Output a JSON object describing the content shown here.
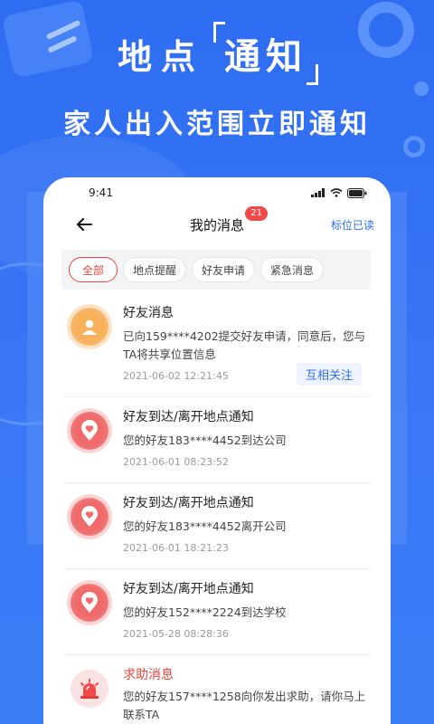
{
  "promo": {
    "headline_left": "地点",
    "headline_right": "通知",
    "subline": "家人出入范围立即通知"
  },
  "status_bar": {
    "time": "9:41"
  },
  "nav": {
    "title": "我的消息",
    "badge": "21",
    "mark_read": "标位已读"
  },
  "tabs": [
    {
      "label": "全部",
      "active": true
    },
    {
      "label": "地点提醒",
      "active": false
    },
    {
      "label": "好友申请",
      "active": false
    },
    {
      "label": "紧急消息",
      "active": false
    }
  ],
  "messages": [
    {
      "icon": "user-icon",
      "title": "好友消息",
      "desc": "已向159****4202提交好友申请，同意后，您与TA将共享位置信息",
      "time": "2021-06-02  12:21:45",
      "action": "互相关注"
    },
    {
      "icon": "location-heart-icon",
      "title": "好友到达/离开地点通知",
      "desc": "您的好友183****4452到达公司",
      "time": "2021-06-01  08:23:52"
    },
    {
      "icon": "location-heart-icon",
      "title": "好友到达/离开地点通知",
      "desc": "您的好友183****4452离开公司",
      "time": "2021-06-01  18:21:23"
    },
    {
      "icon": "location-heart-icon",
      "title": "好友到达/离开地点通知",
      "desc": "您的好友152****2224到达学校",
      "time": "2021-05-28  08:28:36"
    },
    {
      "icon": "alarm-icon",
      "title": "求助消息",
      "desc": "您的好友157****1258向你发出求助，请你马上联系TA"
    }
  ],
  "colors": {
    "brand_blue": "#2f6ff0",
    "alert_red": "#e9443d",
    "badge_red": "#f04b4b"
  }
}
